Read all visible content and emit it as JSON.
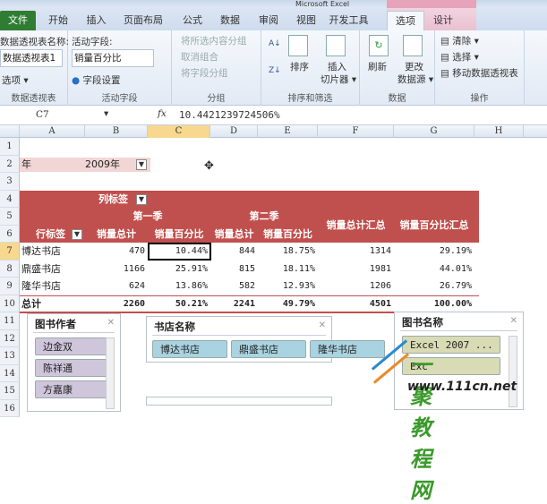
{
  "window": {
    "title_fragment": "Microsoft Excel"
  },
  "tabs": [
    "文件",
    "开始",
    "插入",
    "页面布局",
    "公式",
    "数据",
    "审阅",
    "视图",
    "开发工具",
    "选项",
    "设计"
  ],
  "ribbon": {
    "pivot_name_label": "数据透视表名称:",
    "pivot_name_value": "数据透视表1",
    "options": "选项 ▾",
    "group_pivot": "数据透视表",
    "active_field_label": "活动字段:",
    "active_field_value": "销量百分比",
    "field_settings": "字段设置",
    "group_active": "活动字段",
    "group_sel": "将所选内容分组",
    "ungroup": "取消组合",
    "group_field": "将字段分组",
    "group_group": "分组",
    "sort": "排序",
    "insert_slicer_1": "插入",
    "insert_slicer_2": "切片器 ▾",
    "group_sort": "排序和筛选",
    "refresh": "刷新",
    "change_src_1": "更改",
    "change_src_2": "数据源 ▾",
    "group_data": "数据",
    "clear": "清除 ▾",
    "select": "选择 ▾",
    "move": "移动数据透视表",
    "group_actions": "操作"
  },
  "formula": {
    "cell_ref": "C7",
    "fx": "fx",
    "value": "10.4421239724506%"
  },
  "columns": [
    "A",
    "B",
    "C",
    "D",
    "E",
    "F",
    "G",
    "H"
  ],
  "rows": [
    "1",
    "2",
    "3",
    "4",
    "5",
    "6",
    "7",
    "8",
    "9",
    "10",
    "11",
    "12",
    "13",
    "14",
    "15",
    "16"
  ],
  "filter": {
    "label": "年",
    "value": "2009年"
  },
  "pivot": {
    "col_labels": "列标签",
    "q1": "第一季",
    "q2": "第二季",
    "row_labels": "行标签",
    "headers": [
      "销量总计",
      "销量百分比",
      "销量总计",
      "销量百分比",
      "销量总计汇总",
      "销量百分比汇总"
    ],
    "data": [
      [
        "博达书店",
        "470",
        "10.44%",
        "844",
        "18.75%",
        "1314",
        "29.19%"
      ],
      [
        "鼎盛书店",
        "1166",
        "25.91%",
        "815",
        "18.11%",
        "1981",
        "44.01%"
      ],
      [
        "隆华书店",
        "624",
        "13.86%",
        "582",
        "12.93%",
        "1206",
        "26.79%"
      ],
      [
        "总计",
        "2260",
        "50.21%",
        "2241",
        "49.79%",
        "4501",
        "100.00%"
      ]
    ]
  },
  "slicers": {
    "author": {
      "title": "图书作者",
      "items": [
        "边金双",
        "陈祥通",
        "方嘉康"
      ]
    },
    "store": {
      "title": "书店名称",
      "items": [
        "博达书店",
        "鼎盛书店",
        "隆华书店"
      ]
    },
    "book": {
      "title": "图书名称",
      "items": [
        "Excel 2007 ...",
        "Exc"
      ]
    }
  },
  "watermark": {
    "name": "一聚教程网",
    "url": "www.111cn.net"
  },
  "colors": {
    "pivot_header": "#c0504d",
    "author_item": "#cfc6dc",
    "store_item": "#a9d3e0",
    "book_item": "#d8dbb4"
  }
}
